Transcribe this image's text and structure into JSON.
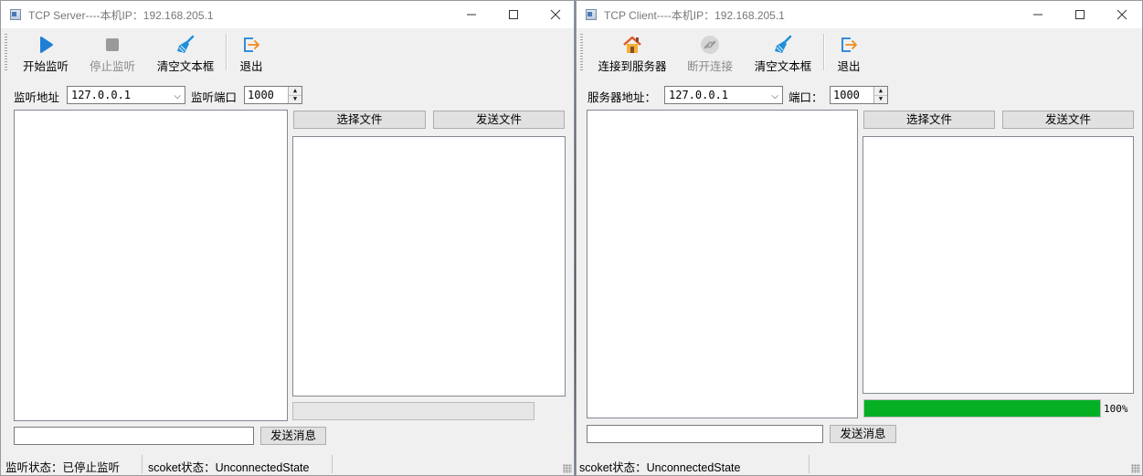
{
  "server": {
    "title": "TCP Server----本机IP：192.168.205.1",
    "toolbar": {
      "start": "开始监听",
      "stop": "停止监听",
      "clear": "清空文本框",
      "exit": "退出"
    },
    "address_label": "监听地址",
    "address_value": "127.0.0.1",
    "port_label": "监听端口",
    "port_value": "1000",
    "select_file": "选择文件",
    "send_file": "发送文件",
    "send_message": "发送消息",
    "status_listen": "监听状态：已停止监听",
    "status_socket": "scoket状态：UnconnectedState"
  },
  "client": {
    "title": "TCP Client----本机IP：192.168.205.1",
    "toolbar": {
      "connect": "连接到服务器",
      "disconnect": "断开连接",
      "clear": "清空文本框",
      "exit": "退出"
    },
    "address_label": "服务器地址：",
    "address_value": "127.0.0.1",
    "port_label": "端口：",
    "port_value": "1000",
    "select_file": "选择文件",
    "send_file": "发送文件",
    "send_message": "发送消息",
    "progress_value": 100,
    "progress_text": "100%",
    "status_socket": "scoket状态：UnconnectedState"
  },
  "colors": {
    "progress_fill": "#06b025",
    "play_icon": "#1f7fd6",
    "broom_icon": "#1f8fd8",
    "exit_icon": "#1f7fd6",
    "exit_arrow": "#f08a1c",
    "house_roof": "#e25a2a"
  }
}
